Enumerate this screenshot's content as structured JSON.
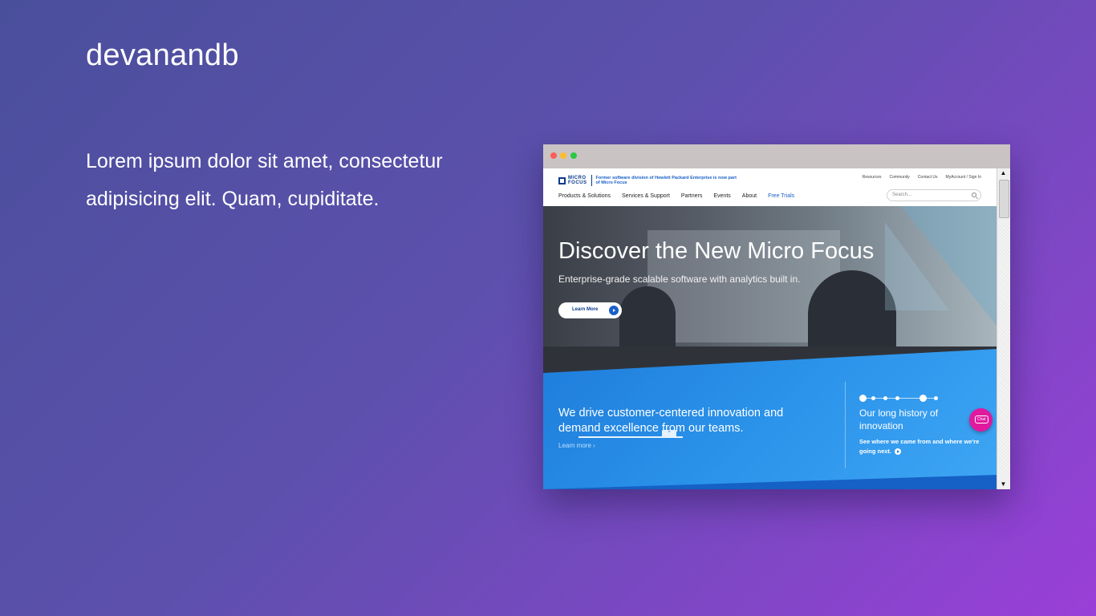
{
  "page": {
    "brand": "devanandb",
    "intro": "Lorem ipsum dolor sit amet, consectetur adipisicing elit. Quam, cupiditate."
  },
  "site": {
    "logo_top": "MICRO",
    "logo_bottom": "FOCUS",
    "logo_note": "Former software division of Hewlett Packard Enterprise is now part of Micro Focus",
    "utility": [
      "Resources",
      "Community",
      "Contact Us",
      "MyAccount / Sign In"
    ],
    "nav": [
      "Products & Solutions",
      "Services & Support",
      "Partners",
      "Events",
      "About",
      "Free Trials"
    ],
    "search_placeholder": "Search..."
  },
  "hero": {
    "title": "Discover the New Micro Focus",
    "subtitle": "Enterprise-grade scalable software with analytics built in.",
    "button": "Learn More"
  },
  "band": {
    "text": "We drive customer-centered innovation and demand excellence from our teams.",
    "link": "Learn more ›",
    "history_title": "Our long history of innovation",
    "history_sub": "See where we came from and where we're going next.",
    "chat": "Chat"
  },
  "colors": {
    "accent": "#1a5fc8",
    "band": "#2b93ea",
    "chat": "#e0199e"
  }
}
